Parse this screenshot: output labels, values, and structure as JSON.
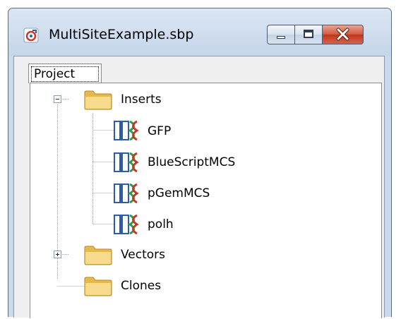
{
  "window": {
    "title": "MultiSiteExample.sbp",
    "minimize_icon": "minimize-icon",
    "maximize_icon": "maximize-icon",
    "close_icon": "close-x-icon"
  },
  "tabs": [
    {
      "label": "Project",
      "selected": true
    }
  ],
  "tree": [
    {
      "label": "Inserts",
      "icon": "folder-icon",
      "expanded": true,
      "children": [
        {
          "label": "GFP",
          "icon": "dna-sequence-icon"
        },
        {
          "label": "BlueScriptMCS",
          "icon": "dna-sequence-icon"
        },
        {
          "label": "pGemMCS",
          "icon": "dna-sequence-icon"
        },
        {
          "label": "polh",
          "icon": "dna-sequence-icon"
        }
      ]
    },
    {
      "label": "Vectors",
      "icon": "folder-icon",
      "expanded": false
    },
    {
      "label": "Clones",
      "icon": "folder-icon"
    }
  ],
  "colors": {
    "titlebar": "#c5d6ea",
    "close_button": "#c03618",
    "folder": "#f5d27a",
    "dna_blue": "#2b5ea8",
    "dna_green": "#3a9b3a",
    "dna_red": "#c0392b"
  }
}
